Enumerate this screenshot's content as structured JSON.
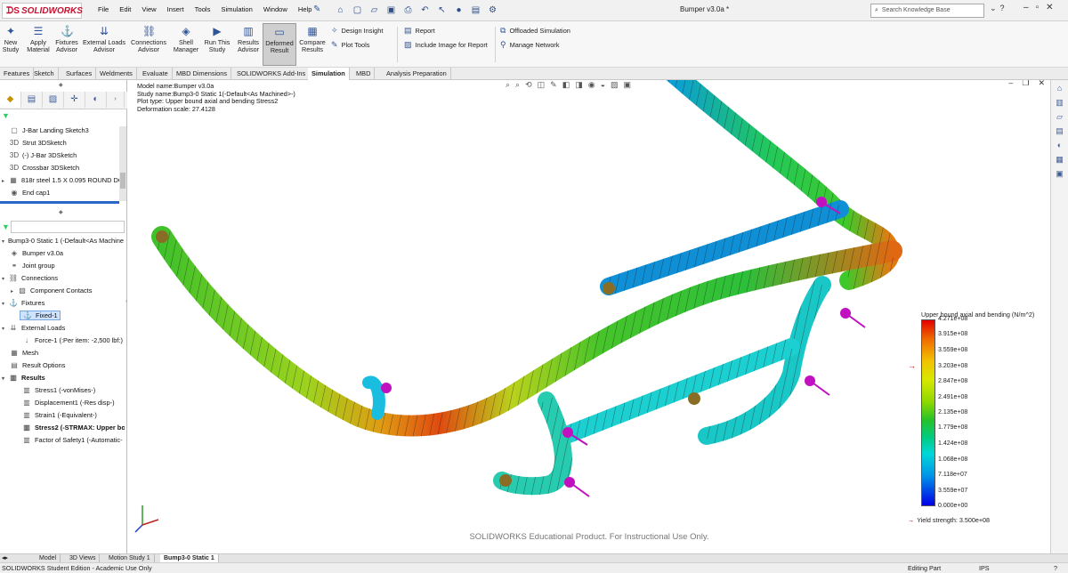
{
  "app": {
    "logo": "SOLIDWORKS",
    "doc_title": "Bumper v3.0a *"
  },
  "menu": [
    "File",
    "Edit",
    "View",
    "Insert",
    "Tools",
    "Simulation",
    "Window",
    "Help"
  ],
  "search": {
    "placeholder": "Search Knowledge Base"
  },
  "ribbon": {
    "buttons": [
      {
        "label": "New Study",
        "icon": "new-study-icon"
      },
      {
        "label": "Apply Material",
        "icon": "apply-material-icon"
      },
      {
        "label": "Fixtures Advisor",
        "icon": "fixtures-advisor-icon"
      },
      {
        "label": "External Loads Advisor",
        "icon": "external-loads-icon"
      },
      {
        "label": "Connections Advisor",
        "icon": "connections-advisor-icon"
      },
      {
        "label": "Shell Manager",
        "icon": "shell-manager-icon"
      },
      {
        "label": "Run This Study",
        "icon": "run-study-icon"
      },
      {
        "label": "Results Advisor",
        "icon": "results-advisor-icon"
      },
      {
        "label": "Deformed Result",
        "icon": "deformed-result-icon"
      },
      {
        "label": "Compare Results",
        "icon": "compare-results-icon"
      }
    ],
    "small": [
      "Design Insight",
      "Plot Tools",
      "Report",
      "Include Image for Report",
      "Offloaded Simulation",
      "Manage Network"
    ]
  },
  "tabs": [
    "Features",
    "Sketch",
    "Surfaces",
    "Weldments",
    "Evaluate",
    "MBD Dimensions",
    "SOLIDWORKS Add-Ins",
    "Simulation",
    "MBD",
    "Analysis Preparation"
  ],
  "active_tab": "Simulation",
  "tree_top": [
    "J-Bar Landing Sketch3",
    "Strut 3DSketch",
    "(-) J-Bar 3DSketch",
    "Crossbar 3DSketch",
    "818r steel 1.5 X 0.095 ROUND DO",
    "End cap1"
  ],
  "tree_bottom": [
    {
      "label": "Bump3-0 Static 1 (-Default<As Machine"
    },
    {
      "label": "Bumper v3.0a"
    },
    {
      "label": "Joint group"
    },
    {
      "label": "Connections"
    },
    {
      "label": "Component Contacts"
    },
    {
      "label": "Fixtures"
    },
    {
      "label": "Fixed-1"
    },
    {
      "label": "External Loads"
    },
    {
      "label": "Force-1 (:Per item: -2,500 lbf:)"
    },
    {
      "label": "Mesh"
    },
    {
      "label": "Result Options"
    },
    {
      "label": "Results"
    },
    {
      "label": "Stress1 (-vonMises-)"
    },
    {
      "label": "Displacement1 (-Res disp-)"
    },
    {
      "label": "Strain1 (-Equivalent-)"
    },
    {
      "label": "Stress2 (-STRMAX: Upper bo"
    },
    {
      "label": "Factor of Safety1 (-Automatic-"
    }
  ],
  "plot_info": {
    "model": "Model name:Bumper v3.0a",
    "study": "Study name:Bump3-0 Static 1(-Default<As Machined>-)",
    "plot": "Plot type: Upper bound axial and bending Stress2",
    "scale": "Deformation scale: 27.4128"
  },
  "legend": {
    "title": "Upper bound axial and bending (N/m^2)",
    "ticks": [
      "4.271e+08",
      "3.915e+08",
      "3.559e+08",
      "3.203e+08",
      "2.847e+08",
      "2.491e+08",
      "2.135e+08",
      "1.779e+08",
      "1.424e+08",
      "1.068e+08",
      "7.118e+07",
      "3.559e+07",
      "0.000e+00"
    ],
    "yield": "Yield strength: 3.500e+08"
  },
  "watermark": "SOLIDWORKS Educational Product. For Instructional Use Only.",
  "bottom_tabs": [
    "Model",
    "3D Views",
    "Motion Study 1",
    "Bump3-0 Static 1"
  ],
  "status": {
    "left": "SOLIDWORKS Student Edition - Academic Use Only",
    "mode": "Editing Part",
    "units": "IPS"
  },
  "colors": {
    "accent": "#2f5597",
    "brand": "#c8102e"
  }
}
